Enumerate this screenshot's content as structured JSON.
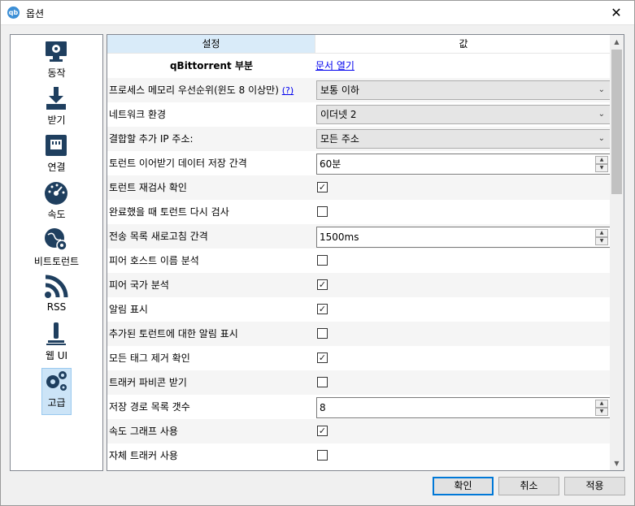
{
  "window": {
    "title": "옵션",
    "logo": "qb"
  },
  "sidebar": {
    "items": [
      {
        "label": "동작",
        "icon": "monitor-gear-icon"
      },
      {
        "label": "받기",
        "icon": "download-icon"
      },
      {
        "label": "연결",
        "icon": "network-port-icon"
      },
      {
        "label": "속도",
        "icon": "speedometer-icon"
      },
      {
        "label": "비트토런트",
        "icon": "globe-gear-icon"
      },
      {
        "label": "RSS",
        "icon": "rss-icon"
      },
      {
        "label": "웹 UI",
        "icon": "web-ui-icon"
      },
      {
        "label": "고급",
        "icon": "gears-icon",
        "active": true
      }
    ]
  },
  "table": {
    "headers": {
      "setting": "설정",
      "value": "값"
    },
    "section": {
      "title": "qBittorrent 부분",
      "link": "문서 열기"
    },
    "rows": [
      {
        "name": "프로세스 메모리 우선순위(윈도 8 이상만)",
        "help": "(?)",
        "type": "combo",
        "value": "보통 이하"
      },
      {
        "name": "네트워크 환경",
        "type": "combo",
        "value": "이더넷 2"
      },
      {
        "name": "결합할 추가 IP 주소:",
        "type": "combo",
        "value": "모든 주소"
      },
      {
        "name": "토런트 이어받기 데이터 저장 간격",
        "type": "spin",
        "value": "60분"
      },
      {
        "name": "토런트 재검사 확인",
        "type": "check",
        "checked": true
      },
      {
        "name": "완료했을 때 토런트 다시 검사",
        "type": "check",
        "checked": false
      },
      {
        "name": "전송 목록 새로고침 간격",
        "type": "spin",
        "value": "1500ms"
      },
      {
        "name": "피어 호스트 이름 분석",
        "type": "check",
        "checked": false
      },
      {
        "name": "피어 국가 분석",
        "type": "check",
        "checked": true
      },
      {
        "name": "알림 표시",
        "type": "check",
        "checked": true
      },
      {
        "name": "추가된 토런트에 대한 알림 표시",
        "type": "check",
        "checked": false
      },
      {
        "name": "모든 태그 제거 확인",
        "type": "check",
        "checked": true
      },
      {
        "name": "트래커 파비콘 받기",
        "type": "check",
        "checked": false
      },
      {
        "name": "저장 경로 목록 갯수",
        "type": "spin",
        "value": "8"
      },
      {
        "name": "속도 그래프 사용",
        "type": "check",
        "checked": true
      },
      {
        "name": "자체 트래커 사용",
        "type": "check",
        "checked": false
      }
    ]
  },
  "buttons": {
    "ok": "확인",
    "cancel": "취소",
    "apply": "적용"
  },
  "glyphs": {
    "close": "✕",
    "check": "✓",
    "arrow_down": "⌄",
    "spin_up": "▲",
    "spin_down": "▼",
    "scroll_up": "▲",
    "scroll_down": "▼"
  }
}
